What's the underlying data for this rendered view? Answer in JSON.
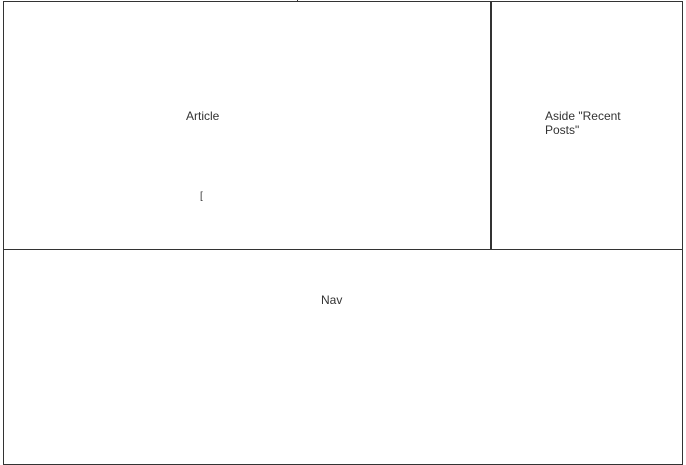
{
  "diagram": {
    "regions": {
      "article": {
        "label": "Article",
        "mark": "["
      },
      "aside": {
        "label": "Aside \"Recent\nPosts\""
      },
      "nav": {
        "label": "Nav"
      }
    },
    "colors": {
      "stroke": "#333333",
      "background": "#ffffff",
      "text": "#333333"
    }
  }
}
